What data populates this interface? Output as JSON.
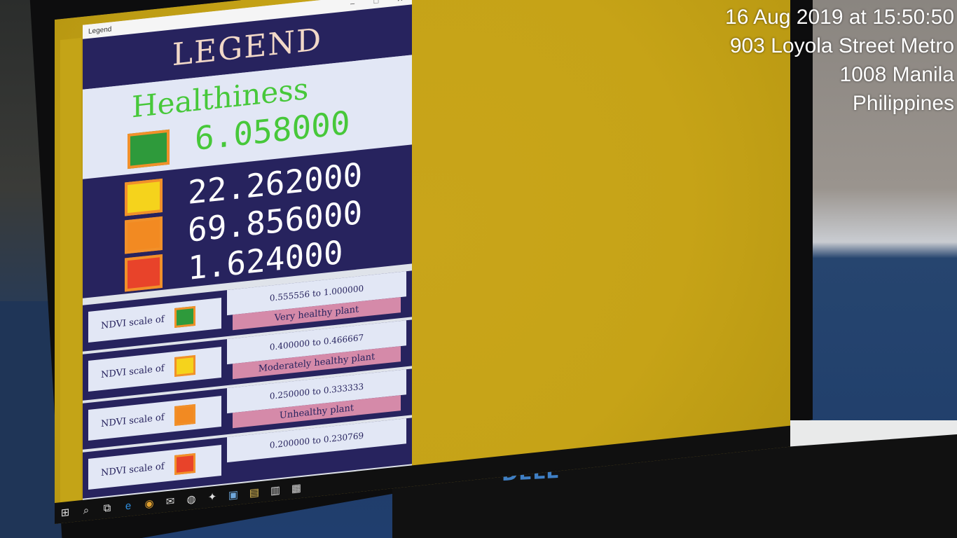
{
  "overlay": {
    "line1": "16 Aug 2019 at 15:50:50",
    "line2": "903 Loyola Street Metro",
    "line3": "1008 Manila",
    "line4": "Philippines"
  },
  "window": {
    "title": "Legend",
    "minimize": "–",
    "maximize": "□",
    "close": "✕"
  },
  "legend": {
    "header": "LEGEND",
    "healthiness_label": "Healthiness",
    "healthy_value": "6.058000",
    "counts": [
      {
        "value": "22.262000",
        "color": "#f5d31c"
      },
      {
        "value": "69.856000",
        "color": "#f28a22"
      },
      {
        "value": "1.624000",
        "color": "#e8432a"
      }
    ],
    "scales": [
      {
        "prefix": "NDVI scale of",
        "color": "#2e9a3b",
        "range": "0.555556  to  1.000000",
        "category": "Very healthy plant"
      },
      {
        "prefix": "NDVI scale of",
        "color": "#f5d31c",
        "range": "0.400000  to  0.466667",
        "category": "Moderately healthy plant"
      },
      {
        "prefix": "NDVI scale of",
        "color": "#f28a22",
        "range": "0.250000  to  0.333333",
        "category": "Unhealthy plant"
      },
      {
        "prefix": "NDVI scale of",
        "color": "#e8432a",
        "range": "0.200000  to  0.230769",
        "category": ""
      }
    ]
  },
  "brand": "DELL",
  "taskbar": {
    "icons": [
      "windows-start-icon",
      "search-icon",
      "task-view-icon",
      "edge-icon",
      "chrome-icon",
      "mail-icon",
      "media-icon",
      "app-icon",
      "save-icon",
      "photos-icon",
      "files-icon",
      "legend-window-icon"
    ]
  },
  "colors": {
    "healthy": "#2e9a3b",
    "accent_border": "#f1902a",
    "panel_dark": "#27235e"
  }
}
